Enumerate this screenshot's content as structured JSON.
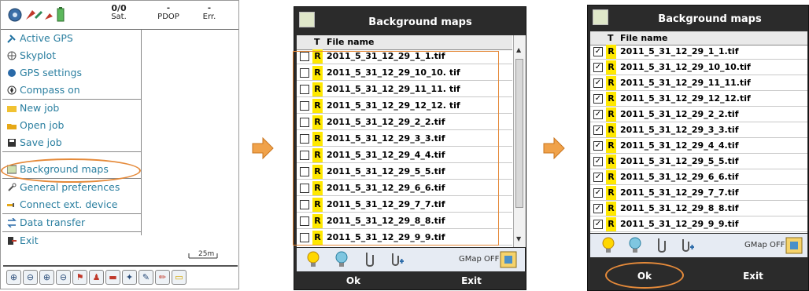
{
  "screen1": {
    "status": {
      "sat_count": "0/0",
      "sat_label": "Sat.",
      "pdop_value": "-",
      "pdop_label": "PDOP",
      "err_value": "-",
      "err_label": "Err."
    },
    "menu": [
      {
        "label": "Active GPS",
        "icon": "satellite-icon"
      },
      {
        "label": "Skyplot",
        "icon": "skyplot-icon"
      },
      {
        "label": "GPS settings",
        "icon": "gps-settings-icon"
      },
      {
        "label": "Compass on",
        "icon": "compass-icon"
      },
      {
        "label": "New job",
        "icon": "new-folder-icon"
      },
      {
        "label": "Open job",
        "icon": "open-folder-icon"
      },
      {
        "label": "Save job",
        "icon": "save-icon"
      },
      {
        "label": "Background maps",
        "icon": "map-icon"
      },
      {
        "label": "General preferences",
        "icon": "wrench-icon"
      },
      {
        "label": "Connect ext. device",
        "icon": "plug-icon"
      },
      {
        "label": "Data transfer",
        "icon": "transfer-icon"
      },
      {
        "label": "Exit",
        "icon": "exit-icon"
      }
    ],
    "scale": "25m"
  },
  "screen2": {
    "title": "Background maps",
    "col_type": "T",
    "col_filename": "File name",
    "files": [
      "2011_5_31_12_29_1_1.tif",
      "2011_5_31_12_29_10_10. tif",
      "2011_5_31_12_29_11_11. tif",
      "2011_5_31_12_29_12_12. tif",
      "2011_5_31_12_29_2_2.tif",
      "2011_5_31_12_29_3_3.tif",
      "2011_5_31_12_29_4_4.tif",
      "2011_5_31_12_29_5_5.tif",
      "2011_5_31_12_29_6_6.tif",
      "2011_5_31_12_29_7_7.tif",
      "2011_5_31_12_29_8_8.tif",
      "2011_5_31_12_29_9_9.tif"
    ],
    "type_tag": "R",
    "gmap": "GMap OFF",
    "ok": "Ok",
    "exit": "Exit"
  },
  "screen3": {
    "title": "Background maps",
    "col_type": "T",
    "col_filename": "File name",
    "files": [
      "2011_5_31_12_29_1_1.tif",
      "2011_5_31_12_29_10_10.tif",
      "2011_5_31_12_29_11_11.tif",
      "2011_5_31_12_29_12_12.tif",
      "2011_5_31_12_29_2_2.tif",
      "2011_5_31_12_29_3_3.tif",
      "2011_5_31_12_29_4_4.tif",
      "2011_5_31_12_29_5_5.tif",
      "2011_5_31_12_29_6_6.tif",
      "2011_5_31_12_29_7_7.tif",
      "2011_5_31_12_29_8_8.tif",
      "2011_5_31_12_29_9_9.tif"
    ],
    "type_tag": "R",
    "gmap": "GMap OFF",
    "ok": "Ok",
    "exit": "Exit"
  },
  "colors": {
    "accent": "#e58a3a",
    "menu_text": "#2b7fa0",
    "tag_yellow": "#ffe800",
    "device_frame": "#2b2b2b"
  }
}
